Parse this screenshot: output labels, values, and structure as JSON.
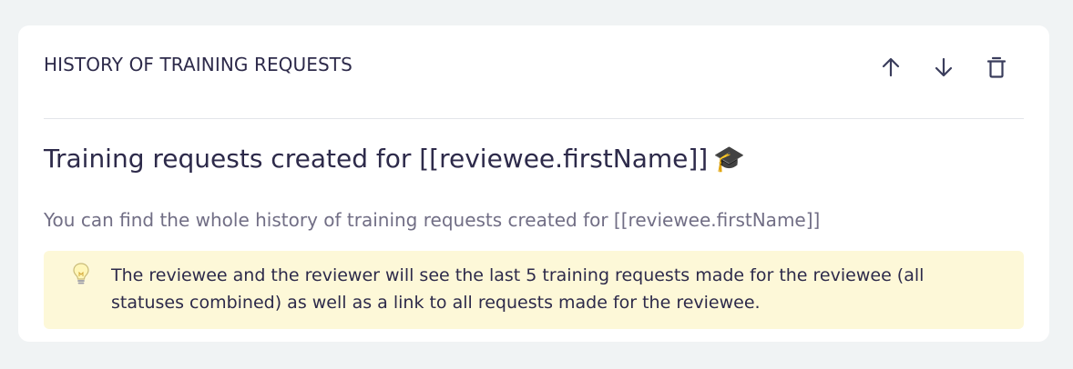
{
  "section": {
    "title": "HISTORY OF TRAINING REQUESTS",
    "actions": {
      "move_up": "arrow-up-icon",
      "move_down": "arrow-down-icon",
      "delete": "trash-icon"
    }
  },
  "content": {
    "heading": "Training requests created for [[reviewee.firstName]]",
    "heading_emoji": "🎓",
    "description": "You can find the whole history of training requests created for [[reviewee.firstName]]",
    "callout": {
      "icon": "lightbulb-icon",
      "text": "The reviewee and the reviewer will see the last 5 training requests made for the reviewee (all statuses combined) as well as a link to all requests made for the reviewee."
    }
  },
  "colors": {
    "page_background": "#f0f3f4",
    "card_background": "#ffffff",
    "text_primary": "#2d2a4a",
    "text_secondary": "#716e85",
    "callout_background": "#fdf8d8",
    "divider": "#e3e5ea"
  }
}
